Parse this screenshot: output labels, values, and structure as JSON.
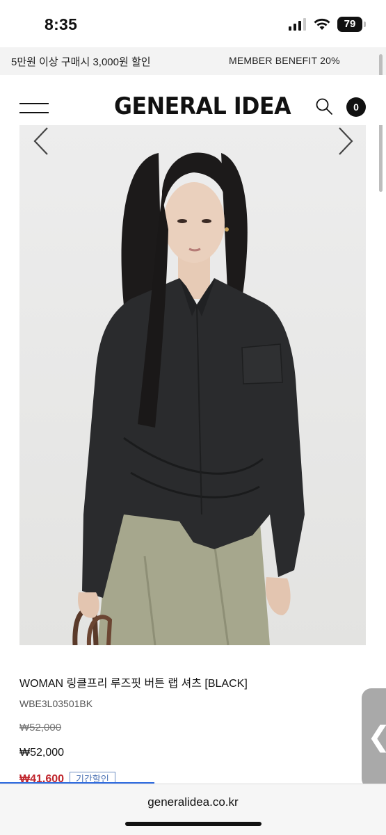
{
  "status_bar": {
    "time": "8:35",
    "battery": "79"
  },
  "promo": {
    "left": "5만원 이상 구매시 3,000원 할인",
    "right": "MEMBER BENEFIT 20%"
  },
  "header": {
    "logo": "GENERAL IDEA",
    "cart_count": "0"
  },
  "product": {
    "title": "WOMAN 링클프리 루즈핏 버튼 랩 셔츠 [BLACK]",
    "code": "WBE3L03501BK",
    "price_original": "₩52,000",
    "price_current": "₩52,000",
    "price_sale": "₩41,600",
    "sale_tag": "기간할인"
  },
  "browser": {
    "url": "generalidea.co.kr",
    "load_progress": 0.4
  },
  "side_tab": {
    "glyph": "❮"
  },
  "icons": [
    "menu-icon",
    "search-icon",
    "chevron-left-icon",
    "chevron-right-icon",
    "signal-icon",
    "wifi-icon",
    "battery-icon"
  ],
  "colors": {
    "sale_red": "#c0262d",
    "tag_blue": "#4e74b5",
    "progress_blue": "#2f6be0"
  }
}
